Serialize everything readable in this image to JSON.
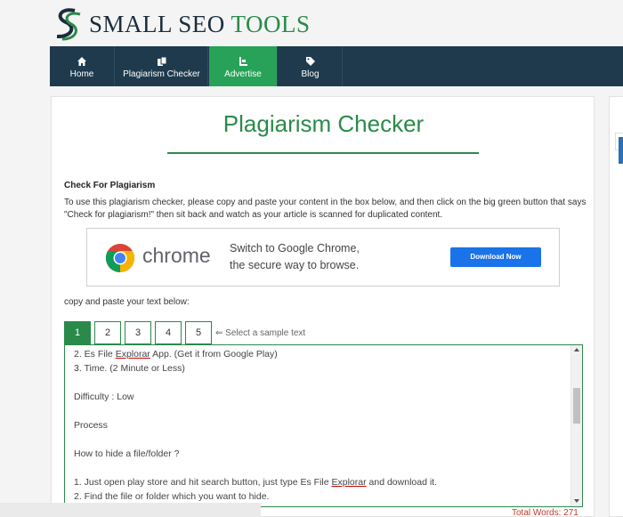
{
  "header": {
    "logo_main": "SMALL SEO ",
    "logo_accent": "TOOLS"
  },
  "nav": {
    "items": [
      {
        "label": "Home",
        "icon": "home-icon"
      },
      {
        "label": "Plagiarism Checker",
        "icon": "copy-icon"
      },
      {
        "label": "Advertise",
        "icon": "advertise-icon"
      },
      {
        "label": "Blog",
        "icon": "tag-icon"
      }
    ],
    "active_index": 2
  },
  "page": {
    "title": "Plagiarism Checker",
    "subhead": "Check For Plagiarism",
    "intro": "To use this plagiarism checker, please copy and paste your content in the box below, and then click on the big green button that says \"Check for plagiarism!\" then sit back and watch as your article is scanned for duplicated content.",
    "copy_label": "copy and paste your text below:"
  },
  "ad": {
    "brand": "chrome",
    "tagline_1": "Switch to Google Chrome,",
    "tagline_2": "the secure way to browse.",
    "button": "Download Now"
  },
  "samples": {
    "buttons": [
      "1",
      "2",
      "3",
      "4",
      "5"
    ],
    "active": "1",
    "hint": "⇐ Select a sample text"
  },
  "editor": {
    "line_1_a": "2. Es File ",
    "line_1_b": "Explorar",
    "line_1_c": " App. (Get it from Google Play)",
    "line_2": "3. Time. (2 Minute or Less)",
    "line_3": "Difficulty : Low",
    "line_4": "Process",
    "line_5": "How to hide a file/folder ?",
    "line_6_a": "1. Just open play store and hit search button, just type Es File ",
    "line_6_b": "Explorar",
    "line_6_c": " and download it.",
    "line_7": "2. Find the file or folder which you want to hide."
  },
  "footer": {
    "total_words": "Total Words: 271"
  },
  "colors": {
    "brand_green": "#2a8a4a",
    "nav_bg": "#1f3a4d",
    "nav_active": "#27a258",
    "chrome_blue": "#1a73e8"
  }
}
